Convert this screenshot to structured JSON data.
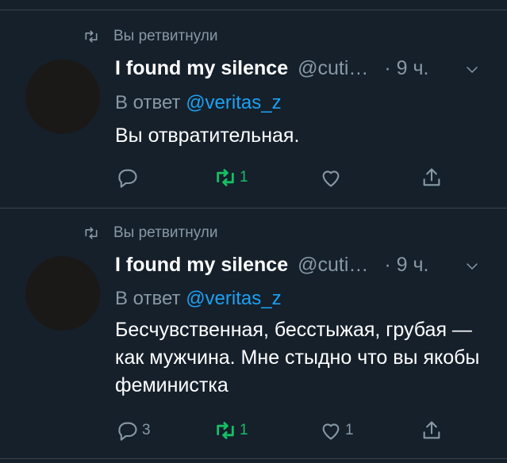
{
  "tweets": [
    {
      "retweet_label": "Вы ретвитнули",
      "name": "I found my silence",
      "handle": "@cuti…",
      "time": "· 9 ч.",
      "reply_prefix": "В ответ",
      "reply_mention": "@veritas_z",
      "body": "Вы отвратительная.",
      "reply_count": "",
      "retweet_count": "1",
      "like_count": ""
    },
    {
      "retweet_label": "Вы ретвитнули",
      "name": "I found my silence",
      "handle": "@cuti…",
      "time": "· 9 ч.",
      "reply_prefix": "В ответ",
      "reply_mention": "@veritas_z",
      "body": "Бесчувственная, бесстыжая, грубая — как мужчина. Мне стыдно что вы якобы феминистка",
      "reply_count": "3",
      "retweet_count": "1",
      "like_count": "1"
    }
  ],
  "colors": {
    "background": "#15202b",
    "muted": "#8899a6",
    "link": "#1da1f2",
    "retweet_active": "#17bf63",
    "divider": "#38444d"
  },
  "icons": [
    "retweet-icon",
    "chevron-down-icon",
    "reply-icon",
    "like-icon",
    "share-icon"
  ]
}
